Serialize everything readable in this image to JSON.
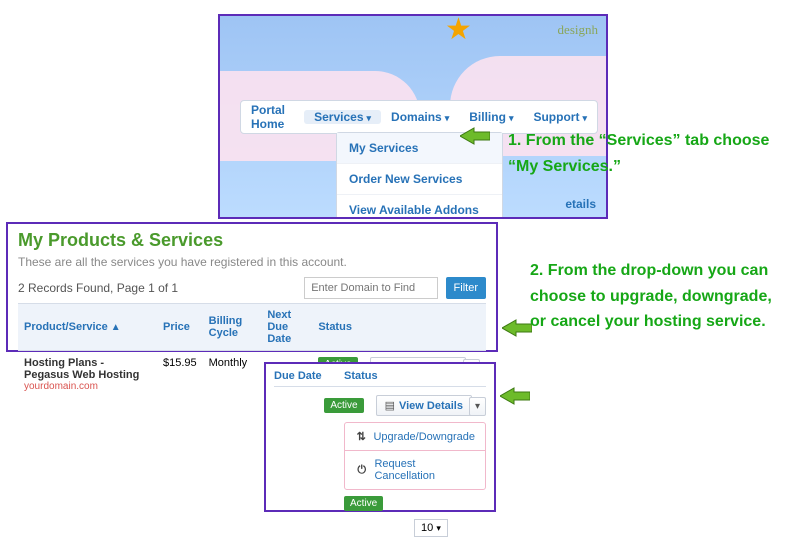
{
  "brand": "designh",
  "nav": {
    "items": [
      {
        "label": "Portal Home",
        "caret": false
      },
      {
        "label": "Services",
        "caret": true
      },
      {
        "label": "Domains",
        "caret": true
      },
      {
        "label": "Billing",
        "caret": true
      },
      {
        "label": "Support",
        "caret": true
      }
    ],
    "dropdown": [
      "My Services",
      "Order New Services",
      "View Available Addons"
    ],
    "details_link": "etails"
  },
  "table": {
    "title": "My Products & Services",
    "subtitle": "These are all the services you have registered in this account.",
    "records": "2 Records Found, Page 1 of 1",
    "search_placeholder": "Enter Domain to Find",
    "filter": "Filter",
    "headers": [
      "Product/Service",
      "Price",
      "Billing Cycle",
      "Next Due Date",
      "Status"
    ],
    "row": {
      "product": "Hosting Plans - Pegasus Web Hosting",
      "domain": "yourdomain.com",
      "price": "$15.95",
      "cycle": "Monthly",
      "status": "Active",
      "view": "View Details"
    }
  },
  "detail": {
    "headers": [
      "Due Date",
      "Status"
    ],
    "status": "Active",
    "view": "View Details",
    "menu": [
      "Upgrade/Downgrade",
      "Request Cancellation"
    ],
    "pagesize": "10"
  },
  "annotations": {
    "a1": "1. From the “Services” tab choose “My Services.”",
    "a2": "2. From the drop-down you can choose to upgrade, downgrade, or cancel your hosting service."
  }
}
